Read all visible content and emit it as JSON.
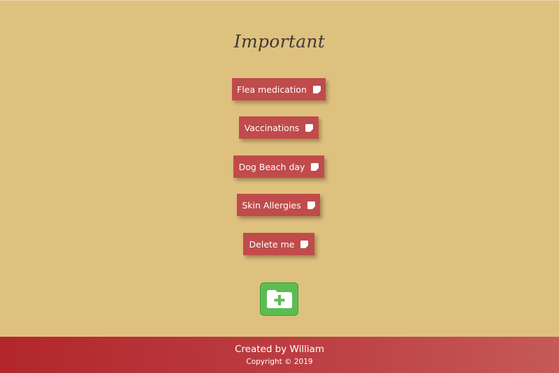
{
  "header": {
    "title": "Important"
  },
  "notes": [
    {
      "label": "Flea medication",
      "icon": "note-icon"
    },
    {
      "label": "Vaccinations",
      "icon": "note-icon"
    },
    {
      "label": "Dog Beach day",
      "icon": "note-icon"
    },
    {
      "label": "Skin Allergies",
      "icon": "note-icon"
    },
    {
      "label": "Delete me",
      "icon": "note-icon"
    }
  ],
  "add_button": {
    "icon": "folder-plus-icon"
  },
  "footer": {
    "credit": "Created by William",
    "copyright": "Copyright © 2019"
  },
  "colors": {
    "background": "#dfc17f",
    "note": "#c04b4b",
    "add_button": "#5cbd52",
    "footer": "#b2262b"
  }
}
